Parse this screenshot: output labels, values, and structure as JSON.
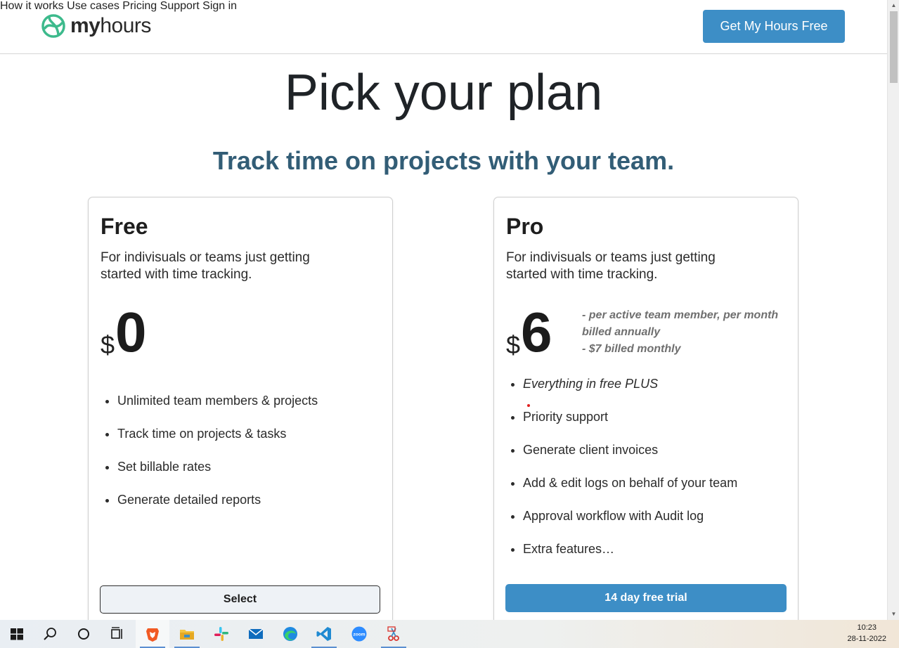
{
  "header": {
    "logo_prefix": "my",
    "logo_suffix": "hours",
    "nav": [
      "How it works",
      "Use cases",
      "Pricing",
      "Support",
      "Sign in"
    ],
    "cta": "Get My Hours Free"
  },
  "hero": {
    "title": "Pick your plan",
    "subtitle": "Track time on projects with your team."
  },
  "plans": [
    {
      "name": "Free",
      "description": "For indivisuals or teams just getting started with time tracking.",
      "currency": "$",
      "price": "0",
      "features": [
        "Unlimited team members & projects",
        "Track time on projects & tasks",
        "Set billable rates",
        "Generate detailed reports"
      ],
      "button": "Select"
    },
    {
      "name": "Pro",
      "description": "For indivisuals or teams just getting started with time tracking.",
      "currency": "$",
      "price": "6",
      "price_note": [
        "- per active team member, per month",
        "billed annually",
        "- $7 billed monthly"
      ],
      "features": [
        "Everything in free PLUS",
        "Priority support",
        "Generate client invoices",
        "Add & edit logs on behalf of your team",
        "Approval workflow with Audit log",
        "Extra features…"
      ],
      "button": "14 day free trial"
    }
  ],
  "taskbar": {
    "icons": [
      "windows-start-icon",
      "search-icon",
      "cortana-icon",
      "task-view-icon",
      "brave-icon",
      "file-explorer-icon",
      "slack-icon",
      "mail-icon",
      "edge-icon",
      "vscode-icon",
      "zoom-icon",
      "snipping-tool-icon"
    ],
    "time": "10:23",
    "date": "28-11-2022"
  },
  "colors": {
    "brand_blue": "#3d8ec6",
    "link_blue": "#3d8bbd",
    "subtitle": "#325d76",
    "logo_green": "#3dba8c"
  }
}
